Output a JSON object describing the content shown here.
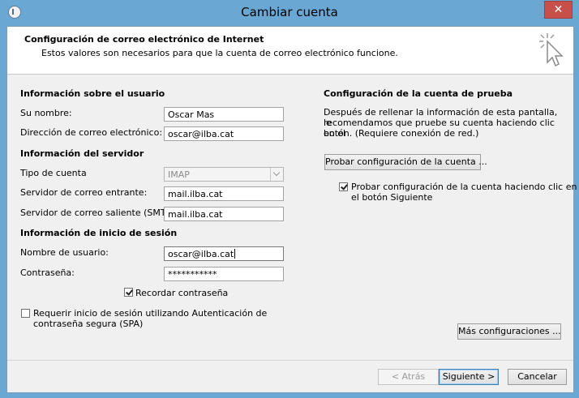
{
  "window": {
    "title": "Cambiar cuenta",
    "close_label": "✕"
  },
  "header": {
    "title": "Configuración de correo electrónico de Internet",
    "subtitle": "Estos valores son necesarios para que la cuenta de correo electrónico funcione."
  },
  "user_info": {
    "heading": "Información sobre el usuario",
    "name_label": "Su nombre:",
    "name_value": "Oscar Mas",
    "email_label": "Dirección de correo electrónico:",
    "email_value": "oscar@ilba.cat"
  },
  "server_info": {
    "heading": "Información del servidor",
    "account_type_label": "Tipo de cuenta",
    "account_type_value": "IMAP",
    "incoming_label": "Servidor de correo entrante:",
    "incoming_value": "mail.ilba.cat",
    "outgoing_label": "Servidor de correo saliente (SMTP):",
    "outgoing_value": "mail.ilba.cat"
  },
  "login_info": {
    "heading": "Información de inicio de sesión",
    "username_label": "Nombre de usuario:",
    "username_value": "oscar@ilba.cat",
    "password_label": "Contraseña:",
    "password_value": "***********",
    "remember_label": "Recordar contraseña",
    "remember_checked": true,
    "spa_label_line1": "Requerir inicio de sesión utilizando Autenticación de",
    "spa_label_line2": "contraseña segura (SPA)",
    "spa_checked": false
  },
  "test_settings": {
    "heading": "Configuración de la cuenta de prueba",
    "description_line1": "Después de rellenar la información de esta pantalla, le",
    "description_line2": "recomendamos que pruebe su cuenta haciendo clic en el",
    "description_line3": "botón. (Requiere conexión de red.)",
    "test_button": "Probar configuración de la cuenta ...",
    "auto_test_label_line1": "Probar configuración de la cuenta haciendo clic en",
    "auto_test_label_line2": "el botón Siguiente",
    "auto_test_checked": true,
    "more_settings_button": "Más configuraciones ..."
  },
  "footer": {
    "back_button": "< Atrás",
    "next_button": "Siguiente >",
    "cancel_button": "Cancelar"
  },
  "colors": {
    "frame": "#6aa7d2",
    "close": "#c7504a",
    "dialog": "#f0f0f0"
  }
}
